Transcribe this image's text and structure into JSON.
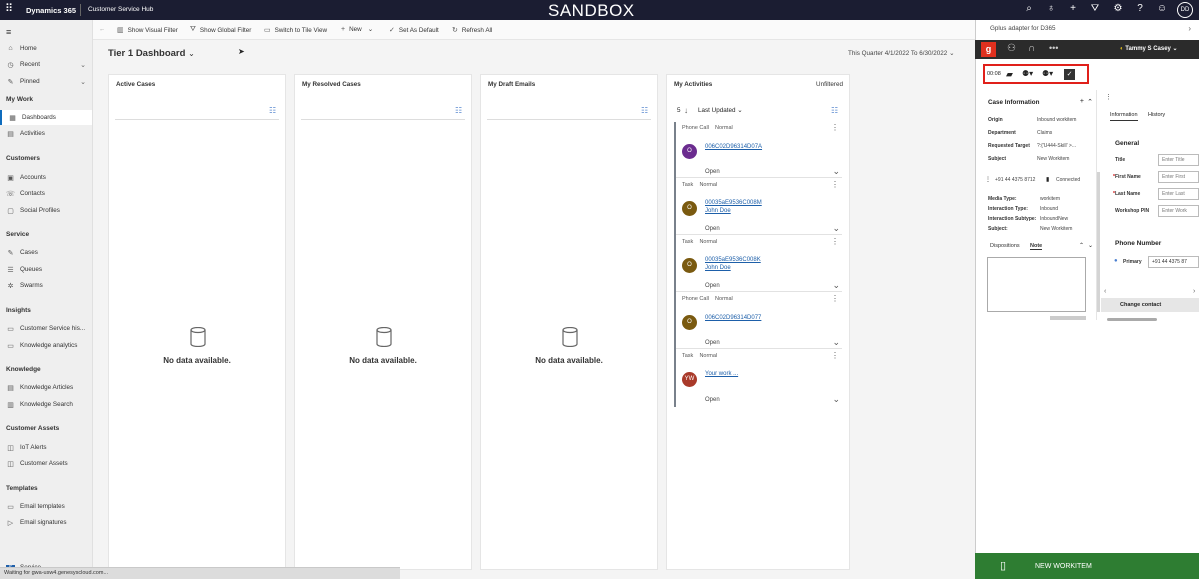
{
  "topbar": {
    "brand": "Dynamics 365",
    "app": "Customer Service Hub",
    "env_label": "SANDBOX",
    "icons": [
      "search-icon",
      "lightbulb-icon",
      "target-icon",
      "plus-icon",
      "filter-icon",
      "gear-icon",
      "help-icon",
      "smiley-icon"
    ],
    "avatar_initials": "DD"
  },
  "nav": {
    "items_top": [
      {
        "label": "Home",
        "icon": "home-icon"
      },
      {
        "label": "Recent",
        "icon": "clock-icon"
      },
      {
        "label": "Pinned",
        "icon": "pin-icon"
      }
    ],
    "sections": [
      {
        "header": "My Work",
        "items": [
          {
            "label": "Dashboards",
            "active": true
          },
          {
            "label": "Activities"
          }
        ]
      },
      {
        "header": "Customers",
        "items": [
          {
            "label": "Accounts"
          },
          {
            "label": "Contacts"
          },
          {
            "label": "Social Profiles"
          }
        ]
      },
      {
        "header": "Service",
        "items": [
          {
            "label": "Cases"
          },
          {
            "label": "Queues"
          },
          {
            "label": "Swarms"
          }
        ]
      },
      {
        "header": "Insights",
        "items": [
          {
            "label": "Customer Service his..."
          },
          {
            "label": "Knowledge analytics"
          }
        ]
      },
      {
        "header": "Knowledge",
        "items": [
          {
            "label": "Knowledge Articles"
          },
          {
            "label": "Knowledge Search"
          }
        ]
      },
      {
        "header": "Customer Assets",
        "items": [
          {
            "label": "IoT Alerts"
          },
          {
            "label": "Customer Assets"
          }
        ]
      },
      {
        "header": "Templates",
        "items": [
          {
            "label": "Email templates"
          },
          {
            "label": "Email signatures"
          }
        ]
      }
    ],
    "area_switcher": "Service"
  },
  "cmdbar": {
    "show_visual_filter": "Show Visual Filter",
    "show_global_filter": "Show Global Filter",
    "switch_tile": "Switch to Tile View",
    "new": "New",
    "set_default": "Set As Default",
    "refresh_all": "Refresh All"
  },
  "dashboard": {
    "title": "Tier 1 Dashboard",
    "date_range": "This Quarter 4/1/2022 To 6/30/2022"
  },
  "cards": [
    {
      "title": "Active Cases",
      "empty": "No data available."
    },
    {
      "title": "My Resolved Cases",
      "empty": "No data available."
    },
    {
      "title": "My Draft Emails",
      "empty": "No data available."
    }
  ],
  "activities": {
    "title": "My Activities",
    "filter_state": "Unfiltered",
    "count": "5",
    "sort": "Last Updated",
    "items": [
      {
        "kind": "Phone Call",
        "priority": "Normal",
        "initial": "O",
        "color": "#6b2c8f",
        "link": "006C02D96314D07A",
        "sub": "",
        "status": "Open"
      },
      {
        "kind": "Task",
        "priority": "Normal",
        "initial": "O",
        "color": "#7a5a10",
        "link": "00035aE9536C008M",
        "sub": "John Doe",
        "status": "Open"
      },
      {
        "kind": "Task",
        "priority": "Normal",
        "initial": "O",
        "color": "#7a5a10",
        "link": "00035aE9536C008K",
        "sub": "John Doe",
        "status": "Open"
      },
      {
        "kind": "Phone Call",
        "priority": "Normal",
        "initial": "O",
        "color": "#7a5a10",
        "link": "006C02D96314D077",
        "sub": "",
        "status": "Open"
      },
      {
        "kind": "Task",
        "priority": "Normal",
        "initial": "YW",
        "color": "#a93a2a",
        "link": "Your work ...",
        "sub": "",
        "status": "Open"
      }
    ]
  },
  "panel": {
    "title": "Gplus adapter for D365",
    "user": "Tammy S Casey",
    "timer": "00:08",
    "case_info": {
      "header": "Case Information",
      "rows": [
        {
          "label": "Origin",
          "value": "Inbound workitem"
        },
        {
          "label": "Department",
          "value": "Claims"
        },
        {
          "label": "Requested Target",
          "value": "?:{'U444-Skill' >..."
        },
        {
          "label": "Subject",
          "value": "New Workitem"
        }
      ],
      "phone": "+91 44 4375 8712",
      "connected": "Connected",
      "media_rows": [
        {
          "label": "Media Type:",
          "value": "workitem"
        },
        {
          "label": "Interaction Type:",
          "value": "Inbound"
        },
        {
          "label": "Interaction Subtype:",
          "value": "InboundNew"
        },
        {
          "label": "Subject:",
          "value": "New Workitem"
        }
      ],
      "tabs": [
        "Dispositions",
        "Note"
      ]
    },
    "contact": {
      "tabs": [
        "Information",
        "History"
      ],
      "section": "General",
      "fields": [
        {
          "label": "Title",
          "placeholder": "Enter Title"
        },
        {
          "label": "First Name",
          "placeholder": "Enter First"
        },
        {
          "label": "Last Name",
          "placeholder": "Enter Last"
        },
        {
          "label": "Workshop PIN",
          "placeholder": "Enter Work"
        }
      ],
      "phone_header": "Phone Number",
      "primary_label": "Primary",
      "primary_value": "+91 44 4375 87",
      "change_contact": "Change contact"
    },
    "new_workitem": "NEW WORKITEM"
  },
  "statusbar": "Waiting for gwa-usw4.genesyscloud.com..."
}
